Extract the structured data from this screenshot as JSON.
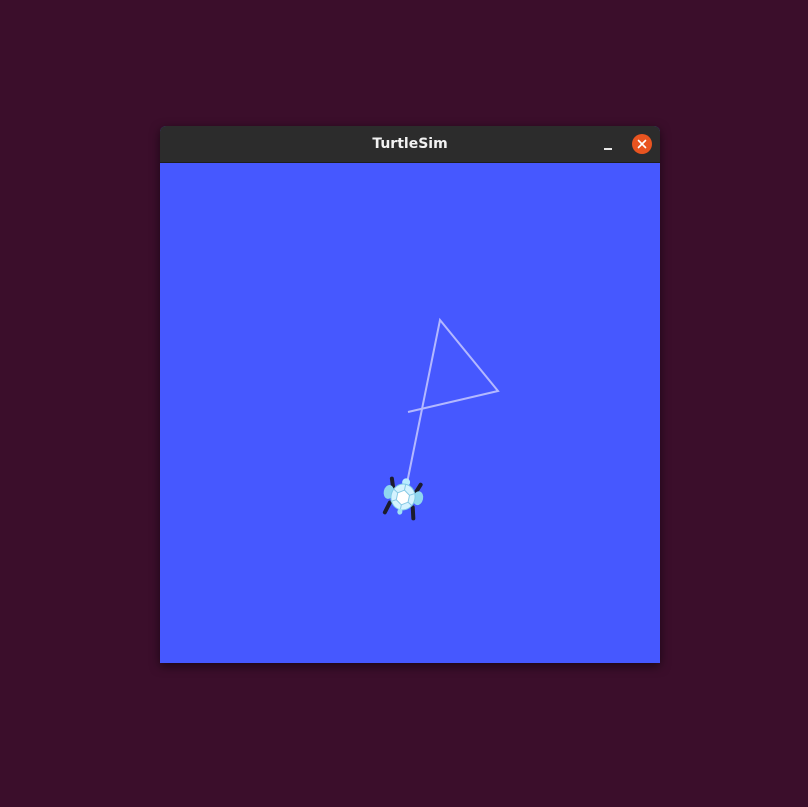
{
  "window": {
    "title": "TurtleSim",
    "background_color": "#4658ff",
    "titlebar_color": "#2c2c2c",
    "close_button_color": "#e95420",
    "desktop_color": "#3b0e2b"
  },
  "controls": {
    "minimize_icon": "minimize-icon",
    "close_icon": "close-icon"
  },
  "scene": {
    "pen_color": "#b3b8ff",
    "turtle_icon": "turtle-icon"
  }
}
